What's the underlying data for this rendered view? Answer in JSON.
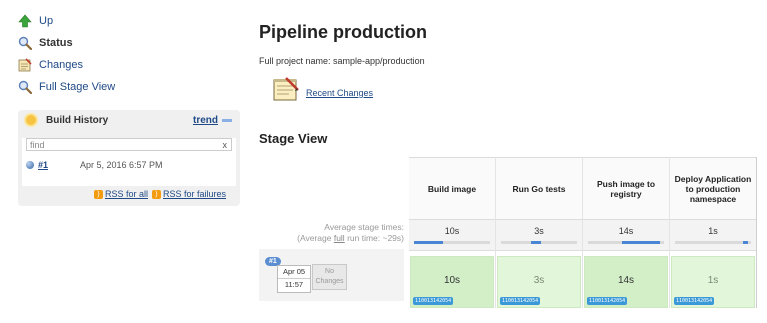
{
  "sidebar": {
    "tasks": [
      {
        "label": "Up",
        "icon": "up-arrow-icon"
      },
      {
        "label": "Status",
        "icon": "magnifier-icon"
      },
      {
        "label": "Changes",
        "icon": "notepad-icon"
      },
      {
        "label": "Full Stage View",
        "icon": "magnifier-icon"
      }
    ]
  },
  "build_history": {
    "title": "Build History",
    "trend": "trend",
    "find_placeholder": "find",
    "clear": "x",
    "builds": [
      {
        "number": "#1",
        "date": "Apr 5, 2016 6:57 PM"
      }
    ],
    "rss_all": "RSS for all",
    "rss_failures": "RSS for failures"
  },
  "main": {
    "title": "Pipeline production",
    "full_name": "Full project name: sample-app/production",
    "recent_changes": "Recent Changes",
    "stage_view_heading": "Stage View"
  },
  "stage_view": {
    "avg_label_1": "Average stage times:",
    "avg_label_2a": "(Average ",
    "avg_label_full": "full",
    "avg_label_2b": " run time: ~29s)",
    "stages": [
      {
        "name": "Build image",
        "avg": "10s",
        "progress": 0.38,
        "duration": "10s",
        "id": "110013142054"
      },
      {
        "name": "Run Go tests",
        "avg": "3s",
        "progress": 0.12,
        "duration": "3s",
        "id": "110013142054"
      },
      {
        "name": "Push image to registry",
        "avg": "14s",
        "progress": 0.5,
        "duration": "14s",
        "id": "110013142054"
      },
      {
        "name": "Deploy Application to production namespace",
        "avg": "1s",
        "progress": 0.04,
        "duration": "1s",
        "id": "110013142054"
      }
    ],
    "run": {
      "badge": "#1",
      "month_day": "Apr 05",
      "time": "11:57",
      "no_changes": "No Changes"
    }
  },
  "colors": {
    "link": "#204a87",
    "success_cell": "#e2f6da",
    "progress": "#4a86d4"
  }
}
